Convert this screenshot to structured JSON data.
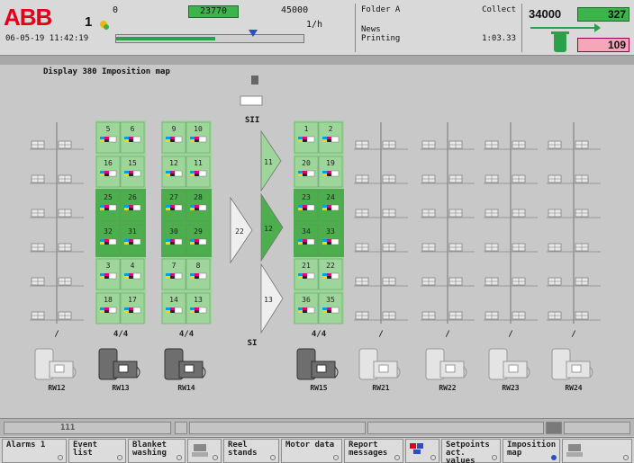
{
  "header": {
    "logo": "ABB",
    "press_number": "1",
    "date": "06-05-19",
    "time": "11:42:19",
    "speed_min": "0",
    "speed_current": "23770",
    "speed_max": "45000",
    "speed_unit": "1/h",
    "speed_fraction": 0.53,
    "speed_setpoint_fraction": 0.73,
    "folder": "Folder A",
    "folder_mode": "Collect",
    "product": "News",
    "status": "Printing",
    "elapsed": "1:03.33",
    "count_target": "34000",
    "count_actual": "327",
    "count_waste": "109"
  },
  "main": {
    "title": "Display 380 Imposition map",
    "folder_top_label": "SII",
    "folder_bottom_label": "SI",
    "triangles": {
      "t11": "11",
      "t12": "12",
      "t13": "13",
      "t22": "22"
    },
    "columns": [
      {
        "name": "RW12",
        "ratio": "/",
        "active": false,
        "pages": []
      },
      {
        "name": "RW13",
        "ratio": "4/4",
        "active": true,
        "pages": [
          "5",
          "6",
          "16",
          "15",
          "25",
          "26",
          "32",
          "31",
          "3",
          "4",
          "18",
          "17"
        ]
      },
      {
        "name": "RW14",
        "ratio": "4/4",
        "active": true,
        "pages": [
          "9",
          "10",
          "12",
          "11",
          "27",
          "28",
          "30",
          "29",
          "7",
          "8",
          "14",
          "13"
        ]
      },
      {
        "name": "RW15",
        "ratio": "4/4",
        "active": true,
        "pages": [
          "1",
          "2",
          "20",
          "19",
          "23",
          "24",
          "34",
          "33",
          "21",
          "22",
          "36",
          "35"
        ]
      },
      {
        "name": "RW21",
        "ratio": "/",
        "active": false,
        "pages": []
      },
      {
        "name": "RW22",
        "ratio": "/",
        "active": false,
        "pages": []
      },
      {
        "name": "RW23",
        "ratio": "/",
        "active": false,
        "pages": []
      },
      {
        "name": "RW24",
        "ratio": "/",
        "active": false,
        "pages": []
      }
    ]
  },
  "status_bar": {
    "indicator": "111"
  },
  "softkeys": [
    {
      "label": "Alarms 1",
      "active": false
    },
    {
      "label": "Event list",
      "active": false
    },
    {
      "label": "Blanket washing",
      "active": false
    },
    {
      "label": "",
      "active": false
    },
    {
      "label": "Reel stands",
      "active": false
    },
    {
      "label": "Motor data",
      "active": false
    },
    {
      "label": "Report messages",
      "active": false
    },
    {
      "label": "",
      "active": false
    },
    {
      "label": "Setpoints act. values",
      "active": false
    },
    {
      "label": "Imposition map",
      "active": true
    },
    {
      "label": "",
      "active": false
    }
  ],
  "colors": {
    "accent_green": "#3cb44b",
    "light_green": "#9ed59b",
    "dark_green": "#4cae4c",
    "warning_pink": "#f6a6b8",
    "brand_red": "#e2001a"
  }
}
